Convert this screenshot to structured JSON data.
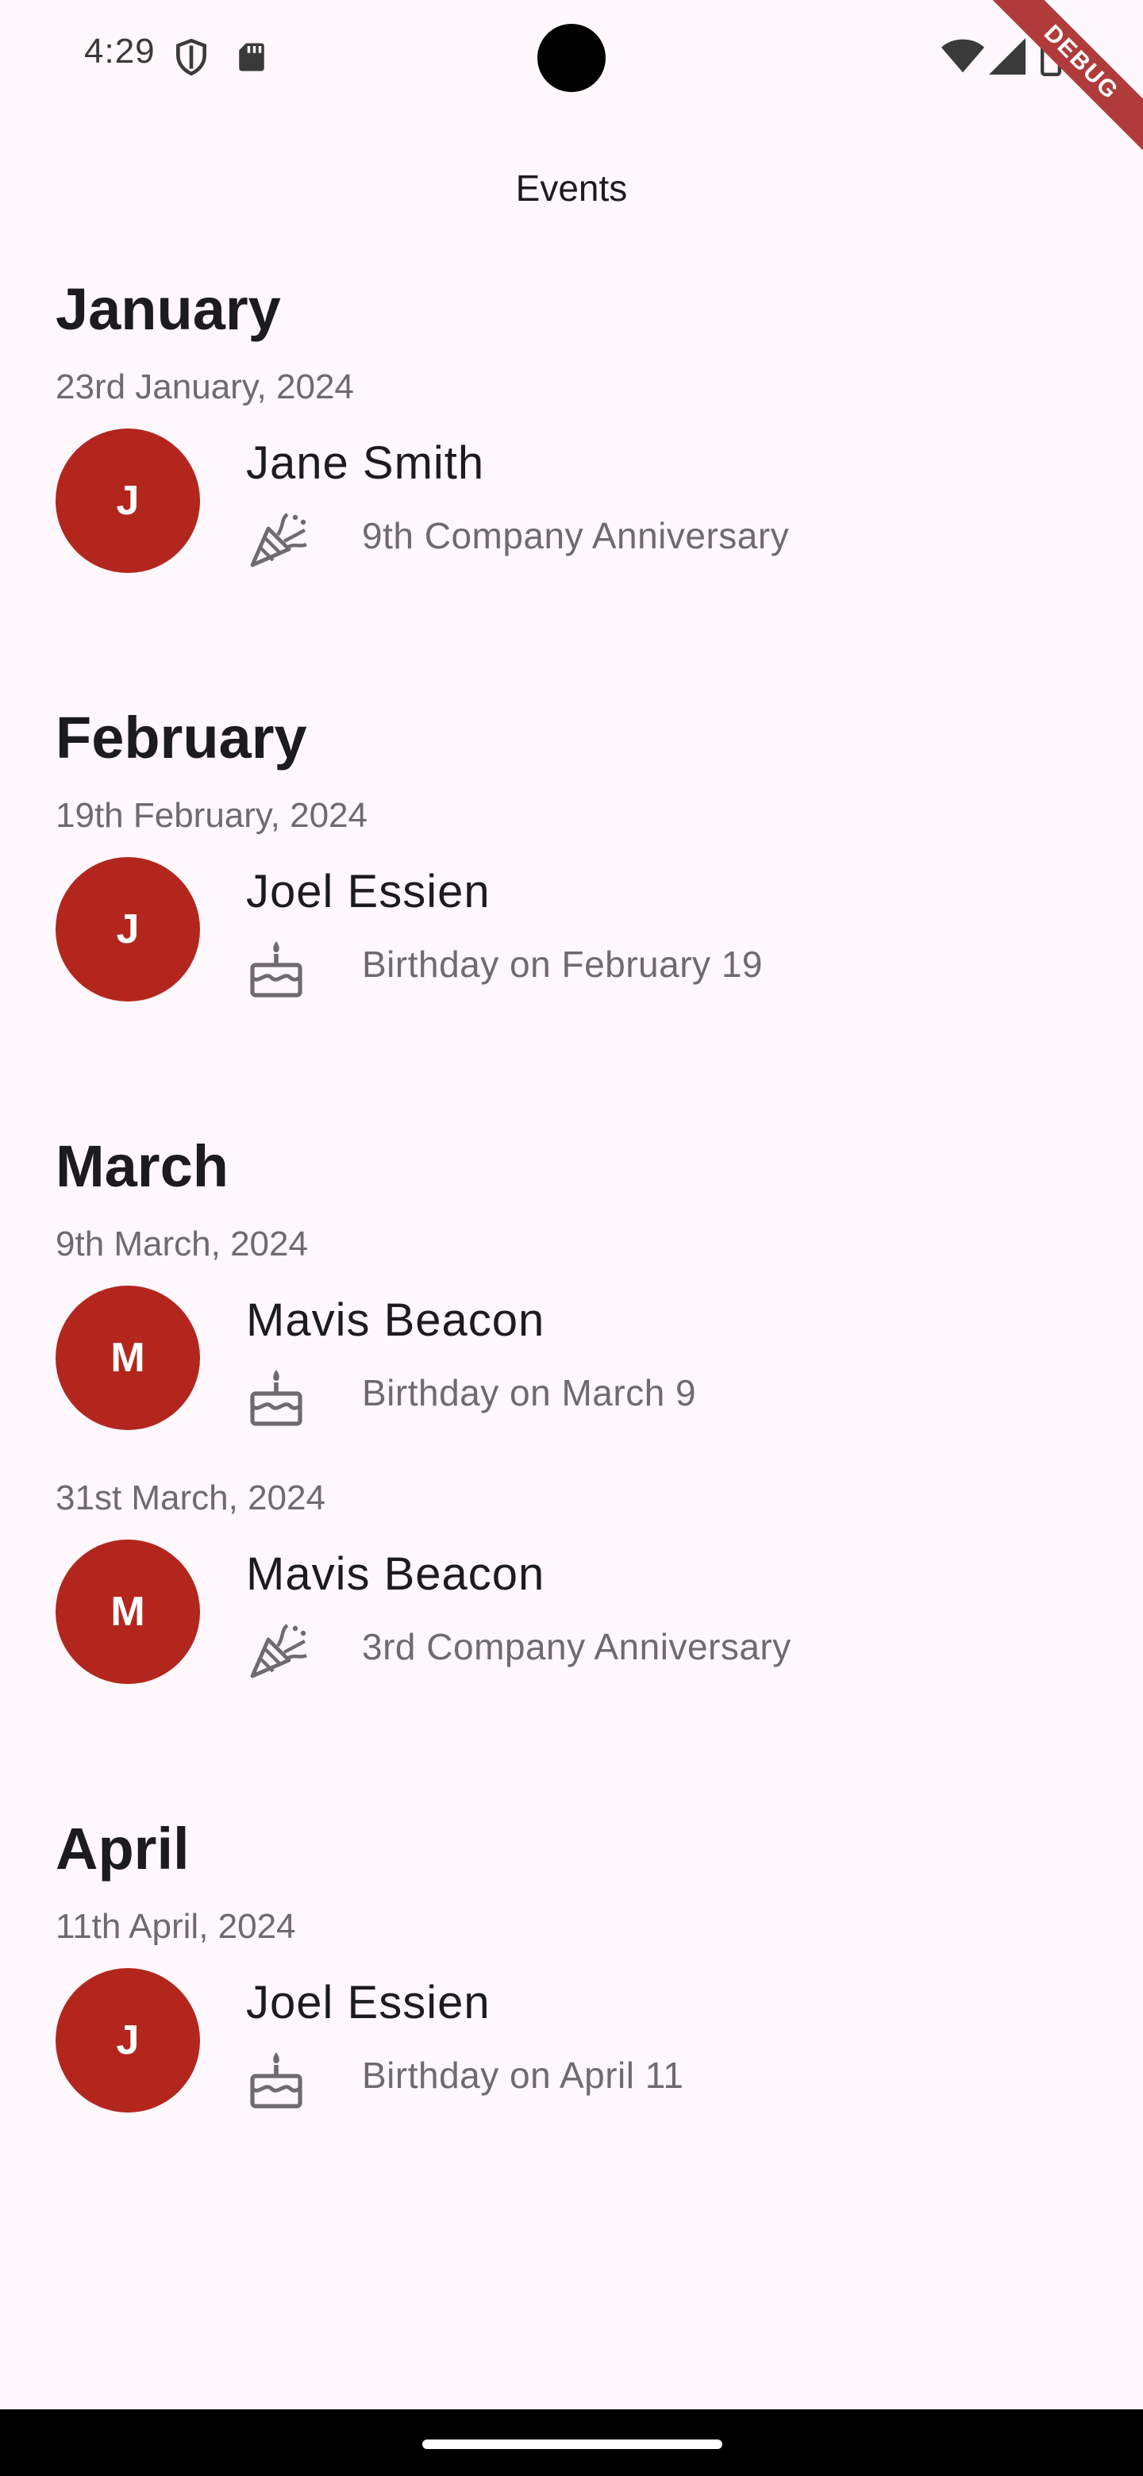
{
  "status_bar": {
    "time": "4:29",
    "icons": [
      "shield-icon",
      "sd-card-icon",
      "wifi-icon",
      "cell-signal-icon",
      "battery-icon"
    ]
  },
  "debug_banner": "DEBUG",
  "app_bar": {
    "title": "Events"
  },
  "colors": {
    "avatar": "#b3261e",
    "background": "#fef7fb",
    "debug": "#b03b3b"
  },
  "months": [
    {
      "name": "January",
      "entries": [
        {
          "date": "23rd January, 2024",
          "initial": "J",
          "name": "Jane Smith",
          "icon": "party-popper-icon",
          "description": "9th Company Anniversary"
        }
      ]
    },
    {
      "name": "February",
      "entries": [
        {
          "date": "19th February, 2024",
          "initial": "J",
          "name": "Joel Essien",
          "icon": "cake-icon",
          "description": "Birthday on February 19"
        }
      ]
    },
    {
      "name": "March",
      "entries": [
        {
          "date": "9th March, 2024",
          "initial": "M",
          "name": "Mavis Beacon",
          "icon": "cake-icon",
          "description": "Birthday on March 9"
        },
        {
          "date": "31st March, 2024",
          "initial": "M",
          "name": "Mavis Beacon",
          "icon": "party-popper-icon",
          "description": "3rd Company Anniversary"
        }
      ]
    },
    {
      "name": "April",
      "entries": [
        {
          "date": "11th April, 2024",
          "initial": "J",
          "name": "Joel Essien",
          "icon": "cake-icon",
          "description": "Birthday on April 11"
        }
      ]
    }
  ]
}
